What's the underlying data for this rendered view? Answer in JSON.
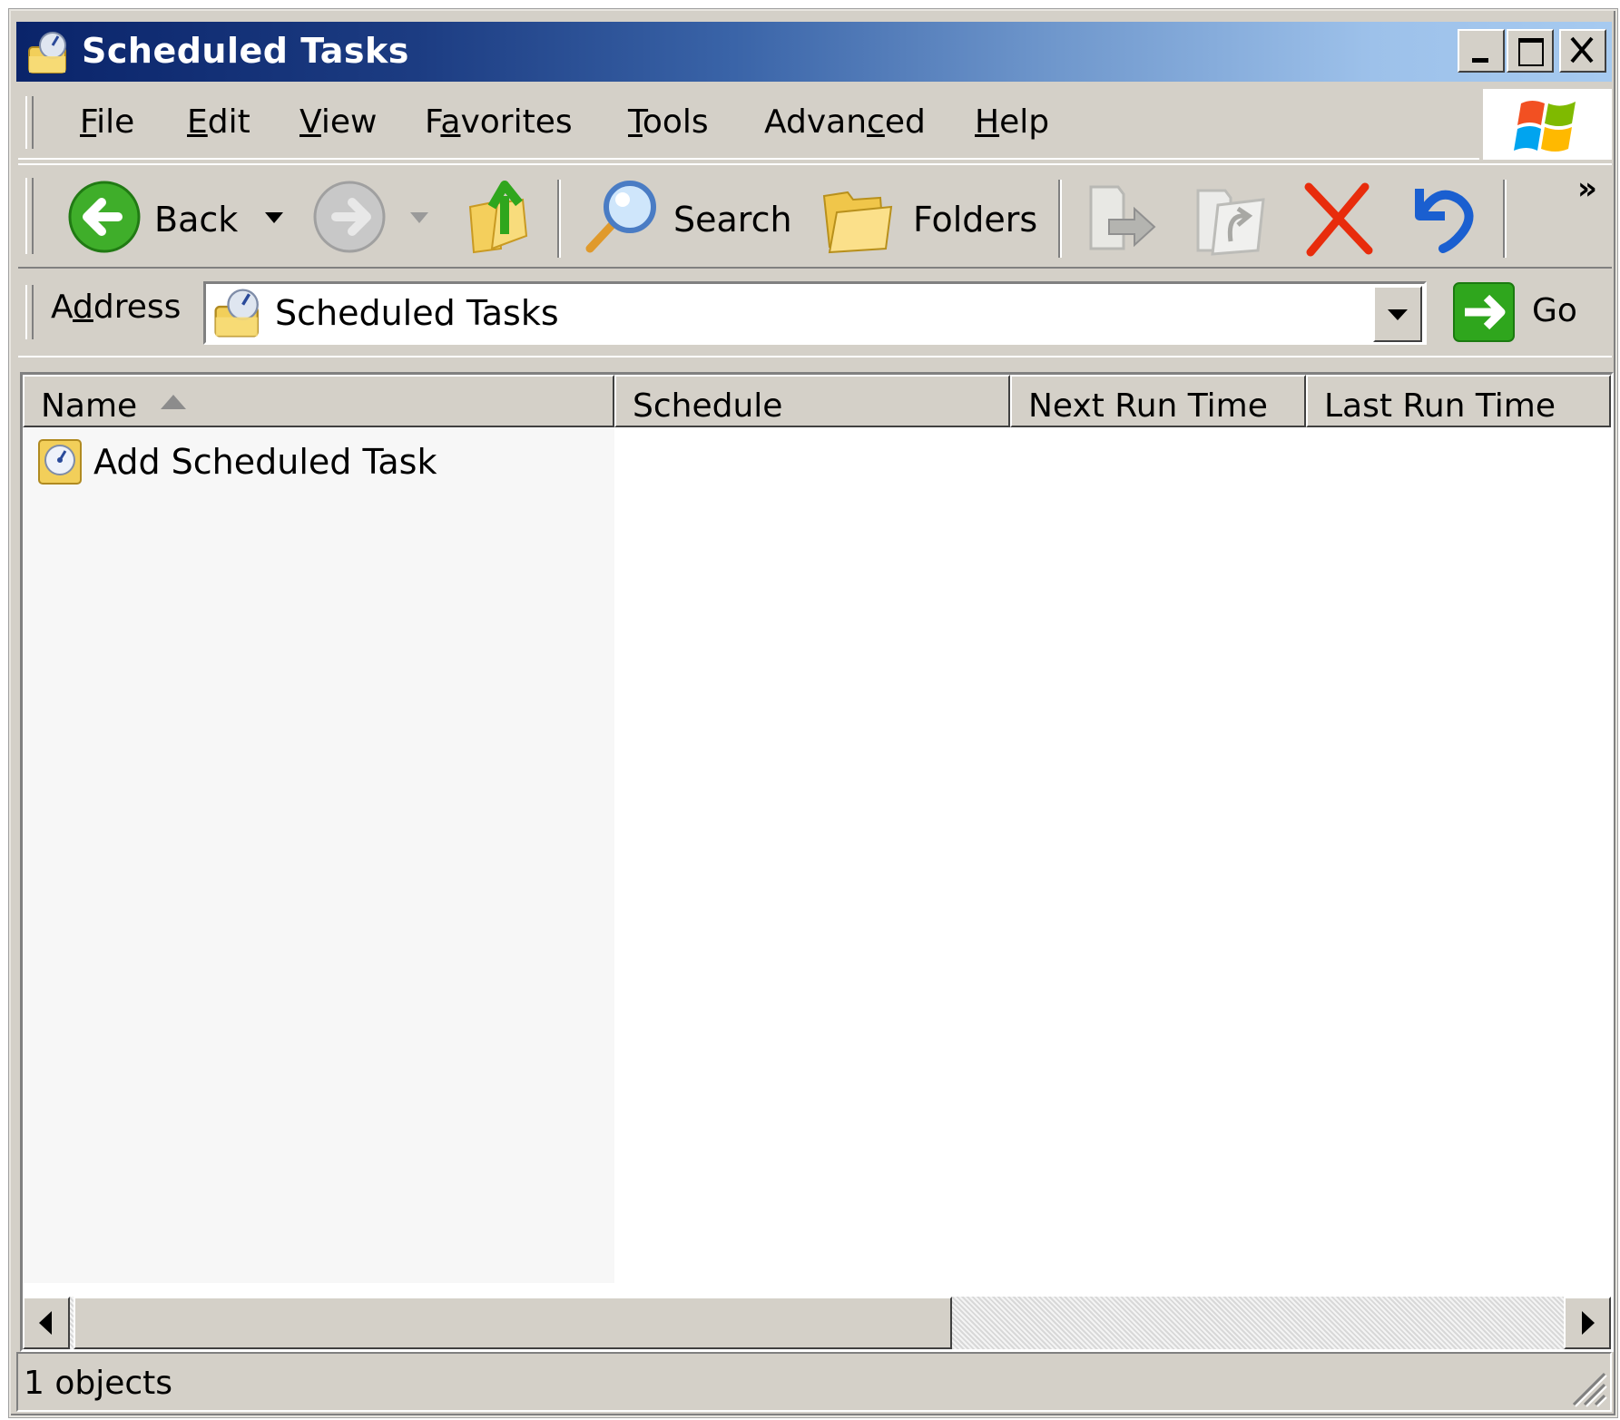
{
  "window": {
    "title": "Scheduled Tasks",
    "controls": {
      "minimize": "_",
      "maximize": "□",
      "close": "✕"
    }
  },
  "menubar": {
    "items": [
      {
        "label": "File",
        "accel": "F"
      },
      {
        "label": "Edit",
        "accel": "E"
      },
      {
        "label": "View",
        "accel": "V"
      },
      {
        "label": "Favorites",
        "accel": "a"
      },
      {
        "label": "Tools",
        "accel": "T"
      },
      {
        "label": "Advanced",
        "accel": "c"
      },
      {
        "label": "Help",
        "accel": "H"
      }
    ]
  },
  "toolbar": {
    "back_label": "Back",
    "search_label": "Search",
    "folders_label": "Folders",
    "overflow": "»",
    "icons": [
      "back-icon",
      "forward-icon",
      "up-folder-icon",
      "search-icon",
      "folders-icon",
      "move-to-icon",
      "copy-to-icon",
      "delete-icon",
      "undo-icon"
    ]
  },
  "address": {
    "label": "Address",
    "value": "Scheduled Tasks",
    "go_label": "Go"
  },
  "list": {
    "columns": [
      "Name",
      "Schedule",
      "Next Run Time",
      "Last Run Time"
    ],
    "sort_column": "Name",
    "sort_direction": "ascending",
    "rows": [
      {
        "name": "Add Scheduled Task",
        "schedule": "",
        "next_run": "",
        "last_run": ""
      }
    ]
  },
  "status": {
    "text": "1 objects"
  }
}
